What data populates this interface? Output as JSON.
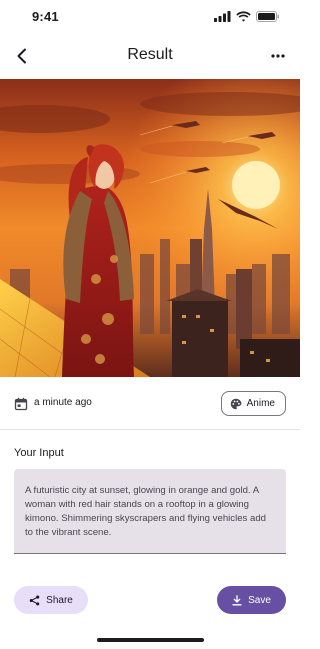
{
  "status_bar": {
    "time": "9:41",
    "icons": [
      "cellular-signal-icon",
      "wifi-icon",
      "battery-icon"
    ]
  },
  "app_bar": {
    "title": "Result",
    "back_icon": "chevron-left-icon",
    "menu_icon": "more-horizontal-icon"
  },
  "image": {
    "alt": "Anime-style woman with red hair in a glowing kimono on a rooftop overlooking a futuristic city at sunset with flying vehicles"
  },
  "meta": {
    "timestamp": "a minute ago",
    "calendar_icon": "calendar-icon",
    "style_label": "Anime",
    "style_icon": "palette-icon"
  },
  "input": {
    "label": "Your Input",
    "prompt": "A futuristic city at sunset, glowing in orange and gold. A woman with red hair stands on a rooftop in a glowing kimono. Shimmering skyscrapers and flying vehicles add to the vibrant scene."
  },
  "actions": {
    "share_label": "Share",
    "share_icon": "share-icon",
    "save_label": "Save",
    "save_icon": "download-icon"
  },
  "colors": {
    "primary": "#6750a4",
    "secondary_container": "#e8def8",
    "surface_variant": "#e6e0e9",
    "outline": "#79747e"
  }
}
